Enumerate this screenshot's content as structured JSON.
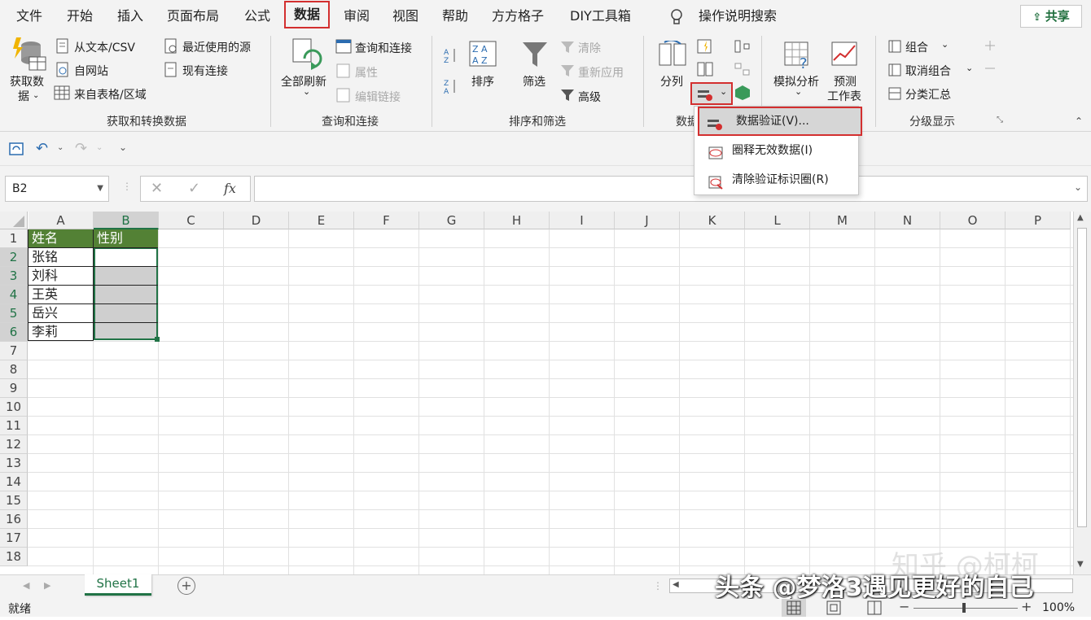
{
  "menu": {
    "items": [
      "文件",
      "开始",
      "插入",
      "页面布局",
      "公式",
      "数据",
      "审阅",
      "视图",
      "帮助",
      "方方格子",
      "DIY工具箱"
    ],
    "tell_me": "操作说明搜索",
    "share": "共享"
  },
  "ribbon": {
    "get_data": {
      "line1": "获取数",
      "line2": "据"
    },
    "from_text_csv": "从文本/CSV",
    "from_web": "自网站",
    "from_table": "来自表格/区域",
    "recent_sources": "最近使用的源",
    "existing_connections": "现有连接",
    "group1_label": "获取和转换数据",
    "refresh_all": "全部刷新",
    "queries_connections": "查询和连接",
    "properties": "属性",
    "edit_links": "编辑链接",
    "group2_label": "查询和连接",
    "sort": "排序",
    "filter": "筛选",
    "clear": "清除",
    "reapply": "重新应用",
    "advanced": "高级",
    "group3_label": "排序和筛选",
    "text_to_columns": "分列",
    "group4_label": "数据",
    "what_if": "模拟分析",
    "forecast": {
      "line1": "预测",
      "line2": "工作表"
    },
    "group": "组合",
    "ungroup": "取消组合",
    "subtotal": "分类汇总",
    "group5_label": "分级显示"
  },
  "dropdown": {
    "items": [
      "数据验证(V)...",
      "圈释无效数据(I)",
      "清除验证标识圈(R)"
    ]
  },
  "formula_bar": {
    "name_box": "B2",
    "fx": "fx",
    "value": ""
  },
  "columns": [
    "A",
    "B",
    "C",
    "D",
    "E",
    "F",
    "G",
    "H",
    "I",
    "J",
    "K",
    "L",
    "M",
    "N",
    "O",
    "P"
  ],
  "rows": [
    "1",
    "2",
    "3",
    "4",
    "5",
    "6",
    "7",
    "8",
    "9",
    "10",
    "11",
    "12",
    "13",
    "14",
    "15",
    "16",
    "17",
    "18"
  ],
  "cells": {
    "A1": "姓名",
    "B1": "性别",
    "A2": "张铭",
    "A3": "刘科",
    "A4": "王英",
    "A5": "岳兴",
    "A6": "李莉"
  },
  "sheet_tabs": [
    "Sheet1"
  ],
  "status": {
    "ready": "就绪",
    "zoom": "100%"
  },
  "watermark": {
    "main": "头条 @梦洛3遇见更好的自己",
    "faint": "知乎 @柯柯"
  },
  "colors": {
    "header_fill": "#538135",
    "gray_fill": "#cfcfcf",
    "highlight": "#d32f2f",
    "excel_green": "#217346"
  }
}
